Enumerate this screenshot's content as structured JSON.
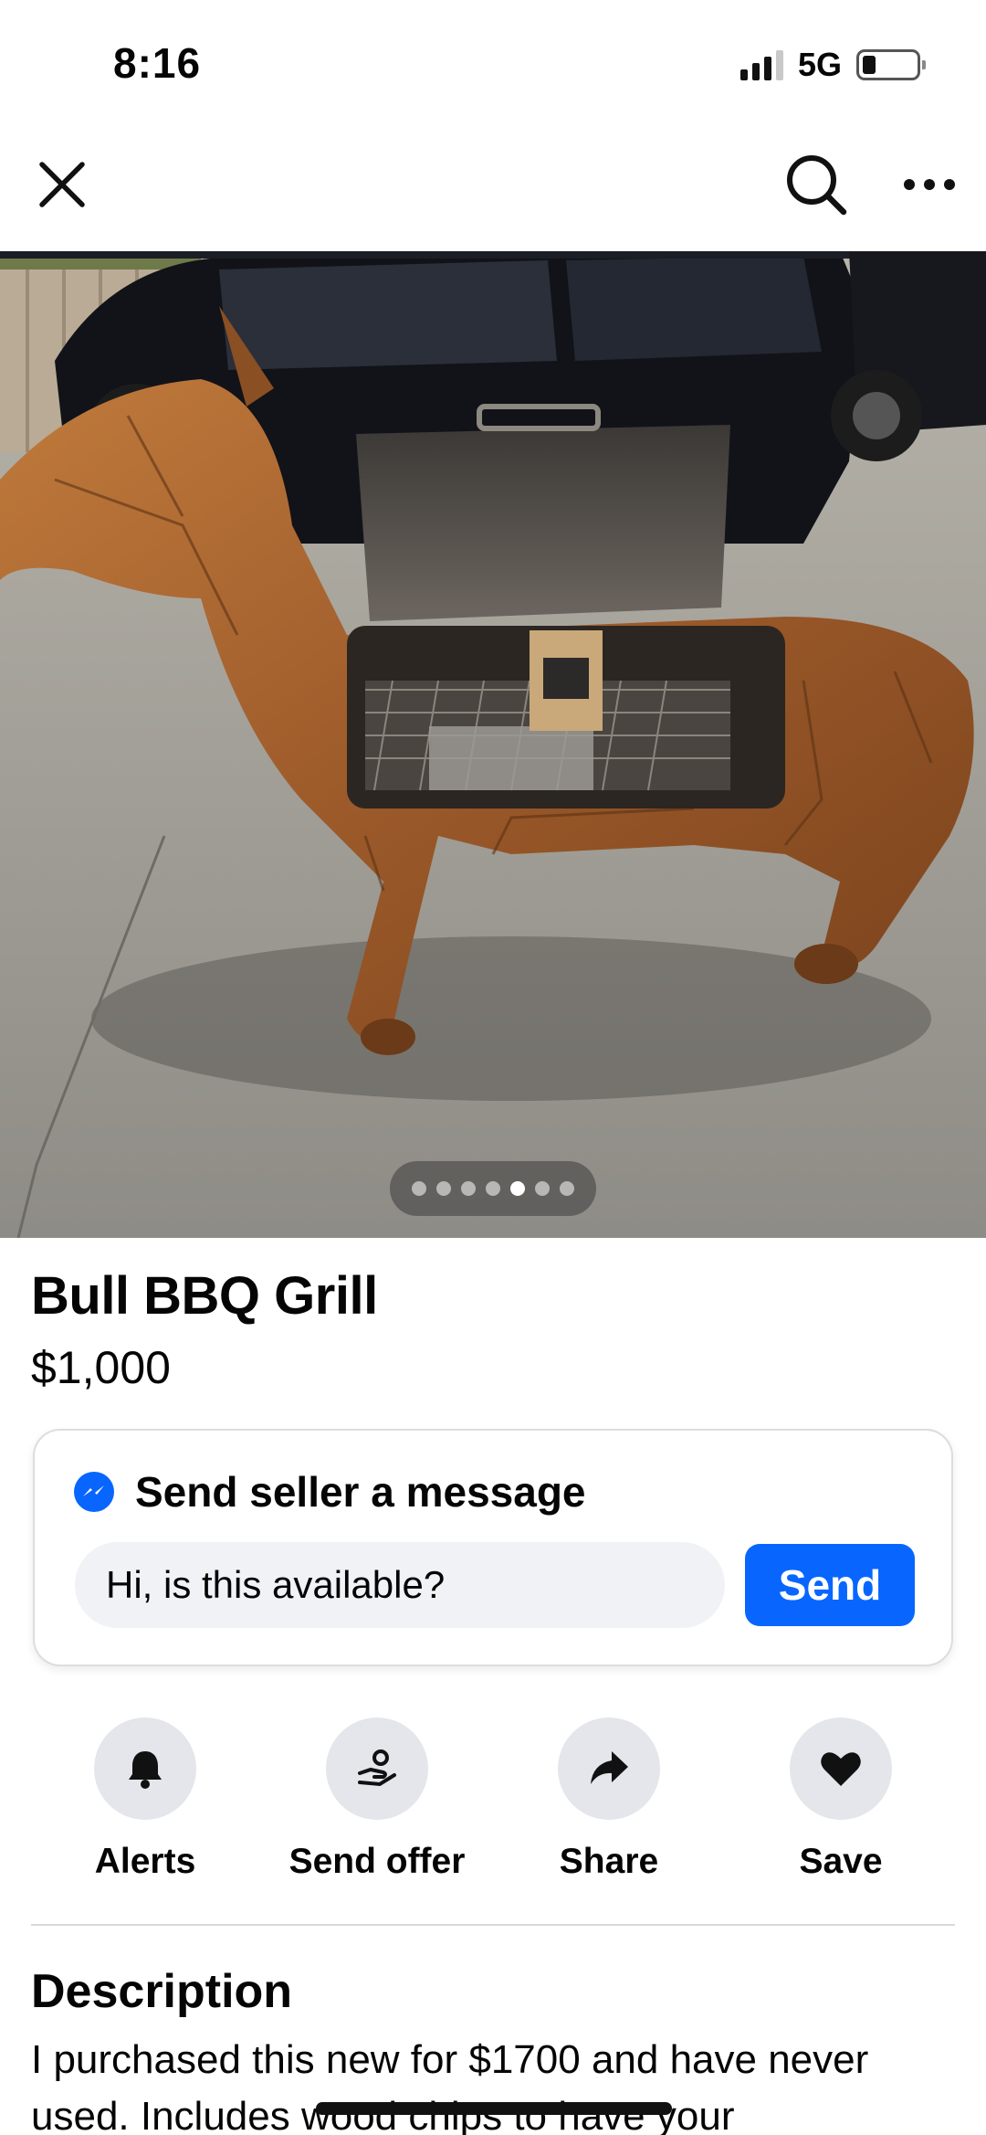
{
  "status_bar": {
    "time": "8:16",
    "network": "5G",
    "signal_bars": 3,
    "battery_level": 0.2
  },
  "nav": {
    "close_icon": "close-icon",
    "search_icon": "search-icon",
    "more_icon": "more-horizontal-icon"
  },
  "photo": {
    "description_icon": "listing-photo",
    "carousel_total": 7,
    "carousel_active": 5
  },
  "listing": {
    "title": "Bull BBQ Grill",
    "price": "$1,000"
  },
  "message_card": {
    "heading": "Send seller a message",
    "input_value": "Hi, is this available?",
    "send_label": "Send",
    "accent_color": "#0866ff"
  },
  "actions": [
    {
      "label": "Alerts",
      "icon": "bell-icon"
    },
    {
      "label": "Send offer",
      "icon": "offer-icon"
    },
    {
      "label": "Share",
      "icon": "share-icon"
    },
    {
      "label": "Save",
      "icon": "heart-icon"
    }
  ],
  "description": {
    "heading": "Description",
    "text": "I purchased this new for $1700 and have never used. Includes wood chips to have your"
  }
}
